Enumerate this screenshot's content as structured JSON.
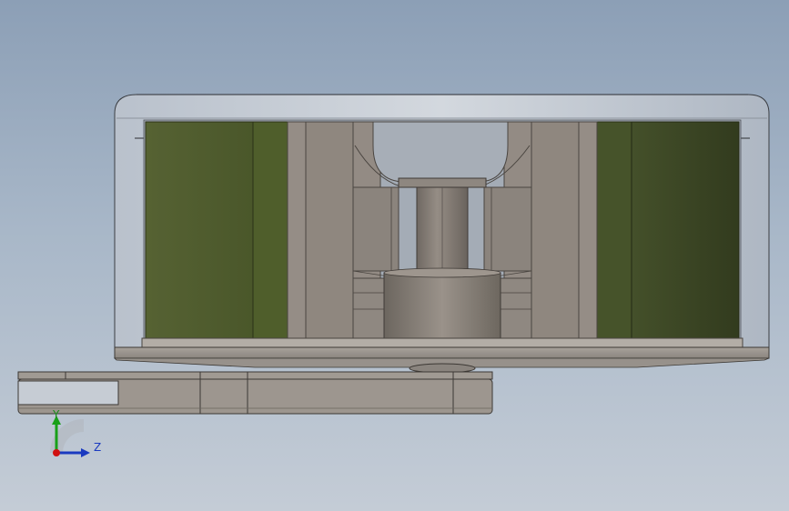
{
  "viewport": {
    "model_view": "cad-section-front-view",
    "background_top": "#8c9fb6",
    "background_bottom": "#c4ccd6"
  },
  "colors": {
    "housing": "#c9ced6",
    "housing_edge": "#33363b",
    "metal": "#8d857e",
    "metal_dark": "#6e6862",
    "coil_left": "#4c5a2a",
    "coil_right": "#3d4823",
    "axis_x": "#d01010",
    "axis_y": "#10a010",
    "axis_z": "#1030c0"
  },
  "triad": {
    "y_label": "Y",
    "z_label": "Z"
  }
}
